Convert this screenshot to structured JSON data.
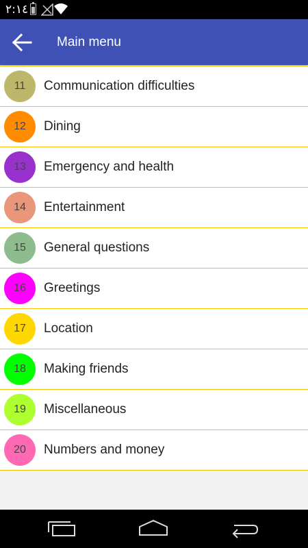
{
  "status_bar": {
    "time": "٢:١٤"
  },
  "app_bar": {
    "title": "Main menu",
    "color": "#3f51b5"
  },
  "list": {
    "divider_color": "#f2c200",
    "items": [
      {
        "number": "11",
        "label": "Communication difficulties",
        "color": "#bdb76b"
      },
      {
        "number": "12",
        "label": "Dining",
        "color": "#ff8c00"
      },
      {
        "number": "13",
        "label": "Emergency and health",
        "color": "#9932cc"
      },
      {
        "number": "14",
        "label": "Entertainment",
        "color": "#e9967a"
      },
      {
        "number": "15",
        "label": "General questions",
        "color": "#8fbc8f"
      },
      {
        "number": "16",
        "label": "Greetings",
        "color": "#ff00ff"
      },
      {
        "number": "17",
        "label": "Location",
        "color": "#ffd700"
      },
      {
        "number": "18",
        "label": "Making friends",
        "color": "#00ff00"
      },
      {
        "number": "19",
        "label": "Miscellaneous",
        "color": "#adff2f"
      },
      {
        "number": "20",
        "label": "Numbers and money",
        "color": "#ff69b4"
      }
    ]
  },
  "nav_bar": {
    "buttons": [
      "recent-apps-icon",
      "home-icon",
      "back-icon"
    ]
  }
}
